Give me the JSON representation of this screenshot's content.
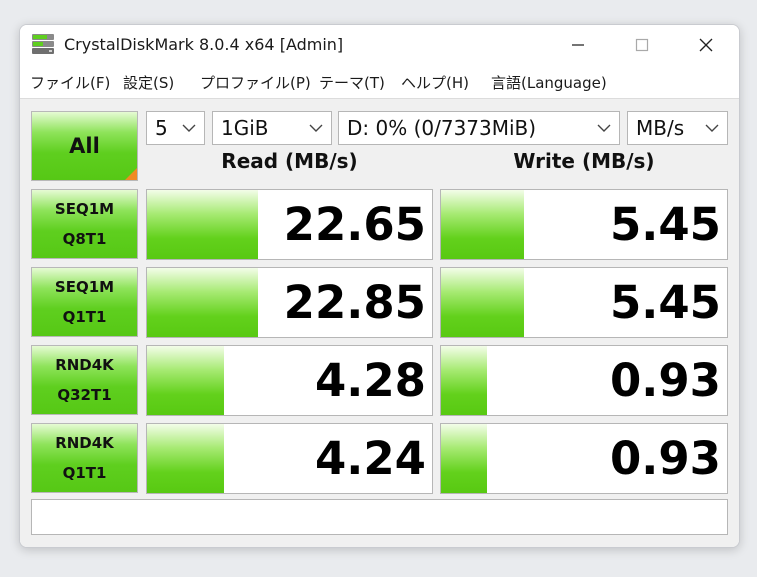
{
  "window": {
    "title": "CrystalDiskMark 8.0.4 x64 [Admin]"
  },
  "menu": [
    {
      "name": "menu-file",
      "label": "ファイル(F)"
    },
    {
      "name": "menu-settings",
      "label": "設定(S)"
    },
    {
      "name": "menu-profile",
      "label": "プロファイル(P)"
    },
    {
      "name": "menu-theme",
      "label": "テーマ(T)"
    },
    {
      "name": "menu-help",
      "label": "ヘルプ(H)"
    },
    {
      "name": "menu-language",
      "label": "言語(Language)"
    }
  ],
  "toolbar": {
    "all_label": "All",
    "count": "5",
    "size": "1GiB",
    "drive": "D: 0% (0/7373MiB)",
    "unit": "MB/s"
  },
  "headers": {
    "read": "Read (MB/s)",
    "write": "Write (MB/s)"
  },
  "rows": [
    {
      "line1": "SEQ1M",
      "line2": "Q8T1",
      "read": "22.65",
      "write": "5.45",
      "read_fill": 0.39,
      "write_fill": 0.29
    },
    {
      "line1": "SEQ1M",
      "line2": "Q1T1",
      "read": "22.85",
      "write": "5.45",
      "read_fill": 0.39,
      "write_fill": 0.29
    },
    {
      "line1": "RND4K",
      "line2": "Q32T1",
      "read": "4.28",
      "write": "0.93",
      "read_fill": 0.27,
      "write_fill": 0.16
    },
    {
      "line1": "RND4K",
      "line2": "Q1T1",
      "read": "4.24",
      "write": "0.93",
      "read_fill": 0.27,
      "write_fill": 0.16
    }
  ],
  "comment": "",
  "colors": {
    "accent_green": "#5fcf1f",
    "corner_orange": "#f08a24"
  },
  "icons": {
    "app": "disk-icon",
    "minimize": "minimize-icon",
    "maximize": "maximize-icon",
    "close": "close-icon",
    "dropdown": "chevron-down-icon"
  }
}
